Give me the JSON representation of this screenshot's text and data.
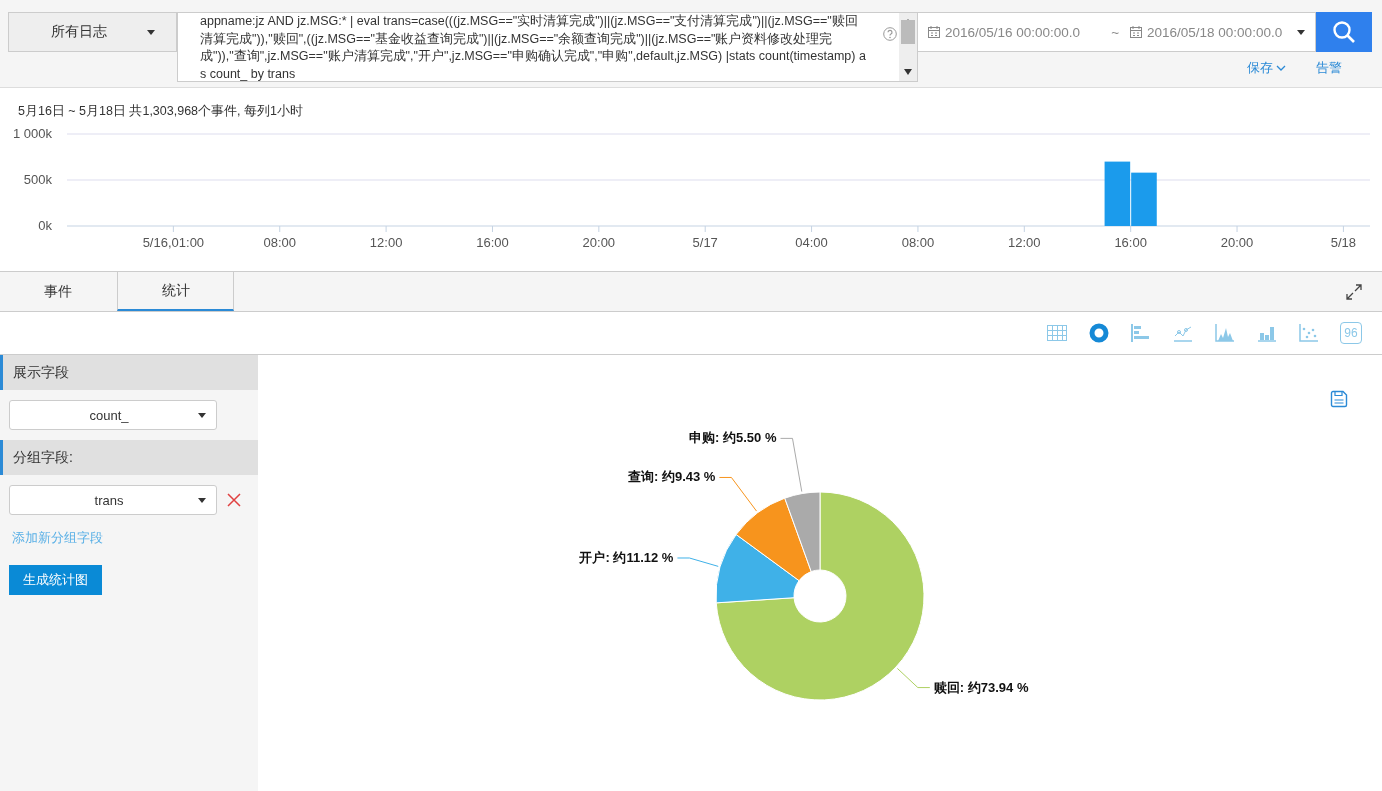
{
  "source_select": {
    "value": "所有日志"
  },
  "query": {
    "value": "appname:jz AND jz.MSG:* | eval trans=case(((jz.MSG==\"实时清算完成\")||(jz.MSG==\"支付清算完成\")||(jz.MSG==\"赎回清算完成\")),\"赎回\",((jz.MSG==\"基金收益查询完成\")||(jz.MSG==\"余额查询完成\")||(jz.MSG==\"账户资料修改处理完成\")),\"查询\",jz.MSG==\"账户清算完成\",\"开户\",jz.MSG==\"申购确认完成\",\"申购\",default,jz.MSG) |stats count(timestamp) as count_ by trans"
  },
  "time_range": {
    "start": "2016/05/16 00:00:00.0",
    "separator": "~",
    "end": "2016/05/18 00:00:00.0"
  },
  "links": [
    {
      "label": "保存",
      "kind": "menu"
    },
    {
      "label": "告警",
      "kind": "link"
    }
  ],
  "histogram": {
    "summary": "5月16日 ~ 5月18日 共1,303,968个事件, 每列1小时",
    "chart_data": {
      "type": "bar",
      "x": [
        "2016-05-17T15:30",
        "2016-05-17T16:30"
      ],
      "values": [
        700000,
        580000
      ],
      "xlim": [
        "2016-05-16T00:00",
        "2016-05-18T01:00"
      ],
      "ylim": [
        0,
        1000000
      ],
      "yticks": [
        {
          "value": 0,
          "label": "0k"
        },
        {
          "value": 500000,
          "label": "500k"
        },
        {
          "value": 1000000,
          "label": "1 000k"
        }
      ],
      "xticks": [
        {
          "value": "2016-05-16T04:00",
          "label": "5/16,01:00"
        },
        {
          "value": "2016-05-16T08:00",
          "label": "08:00"
        },
        {
          "value": "2016-05-16T12:00",
          "label": "12:00"
        },
        {
          "value": "2016-05-16T16:00",
          "label": "16:00"
        },
        {
          "value": "2016-05-16T20:00",
          "label": "20:00"
        },
        {
          "value": "2016-05-17T00:00",
          "label": "5/17"
        },
        {
          "value": "2016-05-17T04:00",
          "label": "04:00"
        },
        {
          "value": "2016-05-17T08:00",
          "label": "08:00"
        },
        {
          "value": "2016-05-17T12:00",
          "label": "12:00"
        },
        {
          "value": "2016-05-17T16:00",
          "label": "16:00"
        },
        {
          "value": "2016-05-17T20:00",
          "label": "20:00"
        },
        {
          "value": "2016-05-18T00:00",
          "label": "5/18"
        }
      ]
    }
  },
  "tabs": [
    {
      "label": "事件",
      "selected": false
    },
    {
      "label": "统计",
      "selected": true
    }
  ],
  "chart_types": [
    {
      "kind": "table",
      "selected": false
    },
    {
      "kind": "donut",
      "selected": true
    },
    {
      "kind": "hbar",
      "selected": false
    },
    {
      "kind": "line",
      "selected": false
    },
    {
      "kind": "area",
      "selected": false
    },
    {
      "kind": "column",
      "selected": false
    },
    {
      "kind": "scatter",
      "selected": false
    },
    {
      "kind": "single_value",
      "label": "96",
      "selected": false
    }
  ],
  "sidebar": {
    "sections": [
      {
        "title": "展示字段",
        "field": "count_",
        "removable": false
      },
      {
        "title": "分组字段:",
        "field": "trans",
        "removable": true
      }
    ],
    "add_link": "添加新分组字段",
    "generate_button": "生成统计图"
  },
  "pie": {
    "chart_data": {
      "type": "donut",
      "categories": [
        "赎回",
        "开户",
        "查询",
        "申购"
      ],
      "values": [
        73.94,
        11.12,
        9.43,
        5.5
      ],
      "value_labels": [
        ": 约73.94 %",
        ": 约11.12 %",
        ": 约9.43 %",
        ": 约5.50 %"
      ]
    }
  }
}
